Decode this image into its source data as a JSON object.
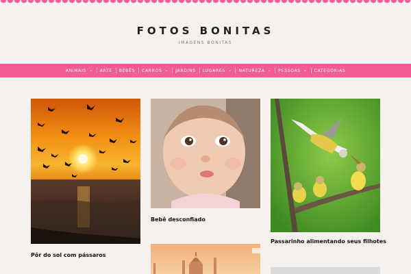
{
  "site": {
    "title": "FOTOS BONITAS",
    "tagline": "IMAGENS BONITAS"
  },
  "nav": {
    "items": [
      {
        "label": "ANIMAIS",
        "has_dropdown": true
      },
      {
        "label": "ARTE",
        "has_dropdown": false
      },
      {
        "label": "BEBÊS",
        "has_dropdown": false
      },
      {
        "label": "CARROS",
        "has_dropdown": true
      },
      {
        "label": "JARDINS",
        "has_dropdown": false
      },
      {
        "label": "LUGARES",
        "has_dropdown": true
      },
      {
        "label": "NATUREZA",
        "has_dropdown": true
      },
      {
        "label": "PESSOAS",
        "has_dropdown": true
      },
      {
        "label": "CATEGORIAS",
        "has_dropdown": false
      }
    ],
    "dropdown_icon": "chevron-down-icon"
  },
  "posts": [
    {
      "title": "Pôr do sol com pássaros",
      "image": "sunset-birds-image"
    },
    {
      "title": "Bebê desconfiado",
      "image": "baby-face-image"
    },
    {
      "title": "Passarinho alimentando seus filhotes",
      "image": "bird-feeding-chicks-image"
    },
    {
      "title": "",
      "image": "taj-mahal-image"
    },
    {
      "title": "",
      "image": "partial-image"
    }
  ],
  "colors": {
    "accent": "#ef5d93",
    "background": "#f4f1ef",
    "title": "#222222"
  }
}
